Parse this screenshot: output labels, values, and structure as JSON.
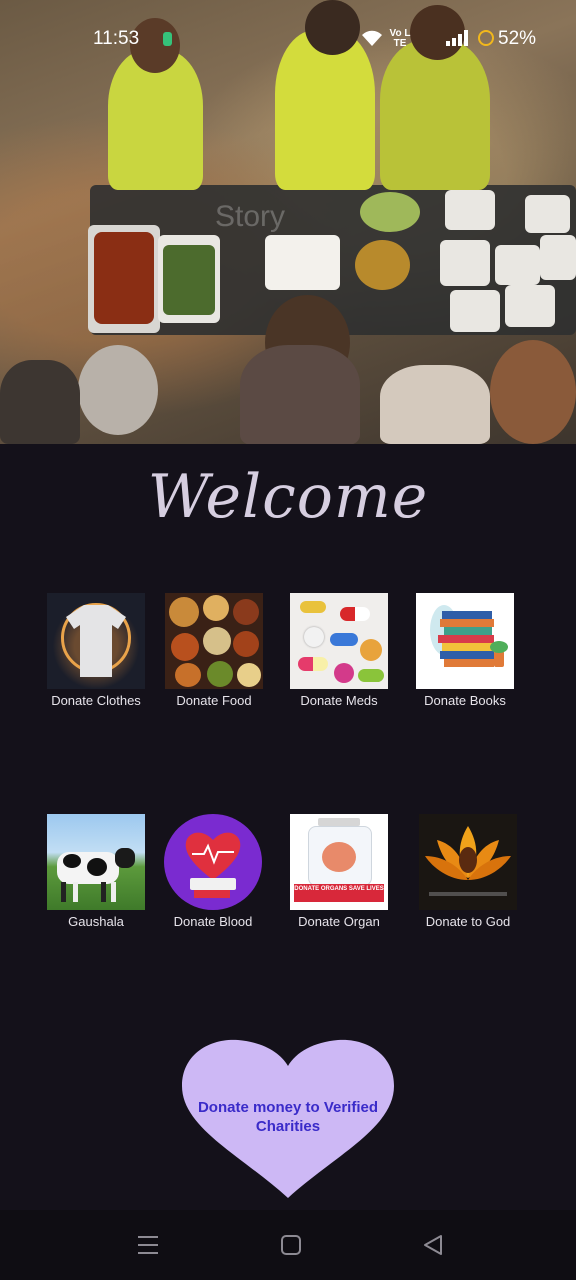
{
  "status_bar": {
    "time": "11:53",
    "network_label": "Vo LTE",
    "battery": "52%"
  },
  "hero": {
    "image": "food-donation-volunteers-photo",
    "watermark": "Story"
  },
  "welcome_title": "Welcome",
  "tiles": [
    {
      "label": "Donate Clothes",
      "icon": "tshirt-image"
    },
    {
      "label": "Donate Food",
      "icon": "food-dishes-image"
    },
    {
      "label": "Donate Meds",
      "icon": "pills-image"
    },
    {
      "label": "Donate Books",
      "icon": "books-stack-image"
    },
    {
      "label": "Gaushala",
      "icon": "cow-image"
    },
    {
      "label": "Donate Blood",
      "icon": "blood-heart-image"
    },
    {
      "label": "Donate Organ",
      "icon": "organ-jar-image",
      "caption": "DONATE ORGANS SAVE LIVES"
    },
    {
      "label": "Donate to God",
      "icon": "lotus-deity-image"
    }
  ],
  "donate_money": {
    "label": "Donate money to Verified Charities",
    "color": "#cdb8f5"
  },
  "nav": {
    "menu": "menu-icon",
    "home": "home-square-icon",
    "back": "back-triangle-icon"
  }
}
